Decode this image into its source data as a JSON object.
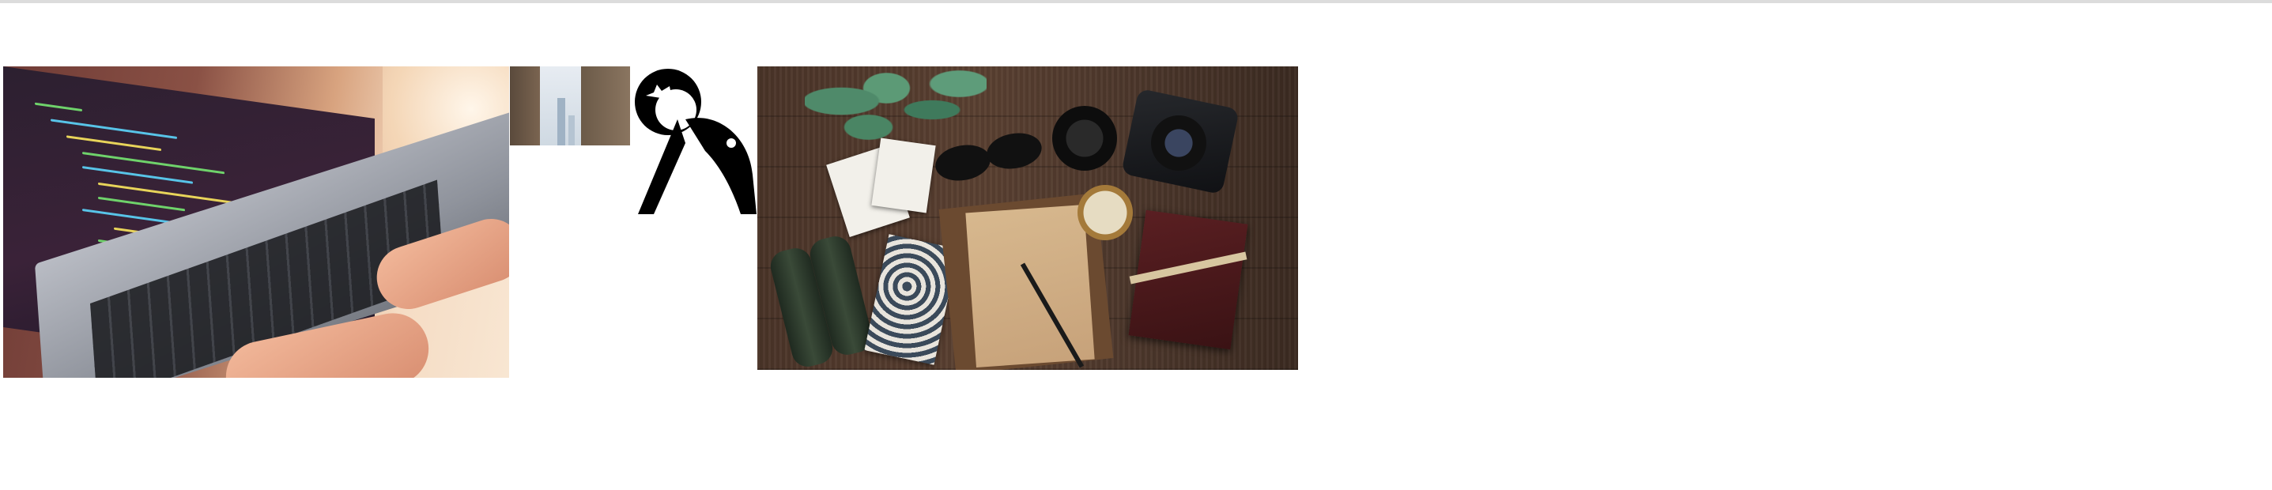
{
  "page": {
    "background": "#ffffff",
    "rule_color": "#dcdcdc"
  },
  "images": [
    {
      "id": "laptop",
      "subject": "hands-typing-on-laptop-with-code"
    },
    {
      "id": "city",
      "subject": "city-street-buildings"
    },
    {
      "id": "logo",
      "subject": "black-logo-mark"
    },
    {
      "id": "travel",
      "subject": "travel-flat-lay-on-wood"
    }
  ]
}
